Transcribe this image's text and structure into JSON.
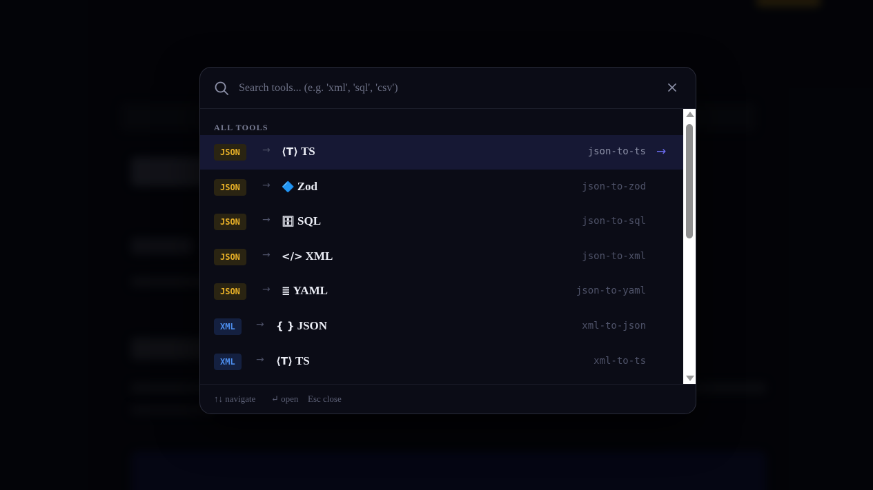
{
  "search": {
    "placeholder": "Search tools... (e.g. 'xml', 'sql', 'csv')",
    "value": ""
  },
  "section_label": "ALL TOOLS",
  "results": [
    {
      "source": "JSON",
      "target_icon": "⟨T⟩",
      "target": "TS",
      "slug": "json-to-ts",
      "active": true
    },
    {
      "source": "JSON",
      "target_icon": "🔷",
      "target": "Zod",
      "slug": "json-to-zod"
    },
    {
      "source": "JSON",
      "target_icon": "🗄",
      "target": "SQL",
      "slug": "json-to-sql"
    },
    {
      "source": "JSON",
      "target_icon": "</>",
      "target": "XML",
      "slug": "json-to-xml"
    },
    {
      "source": "JSON",
      "target_icon": "≣",
      "target": "YAML",
      "slug": "json-to-yaml"
    },
    {
      "source": "XML",
      "target_icon": "{ }",
      "target": "JSON",
      "slug": "xml-to-json"
    },
    {
      "source": "XML",
      "target_icon": "⟨T⟩",
      "target": "TS",
      "slug": "xml-to-ts"
    }
  ],
  "footer": {
    "navigate": "↑↓ navigate",
    "open": "↵ open",
    "close": "Esc close"
  },
  "colors": {
    "json_badge": "#e9b127",
    "xml_badge": "#4d8ff0",
    "accent_arrow": "#6b6cf0",
    "active_row": "#161834"
  }
}
